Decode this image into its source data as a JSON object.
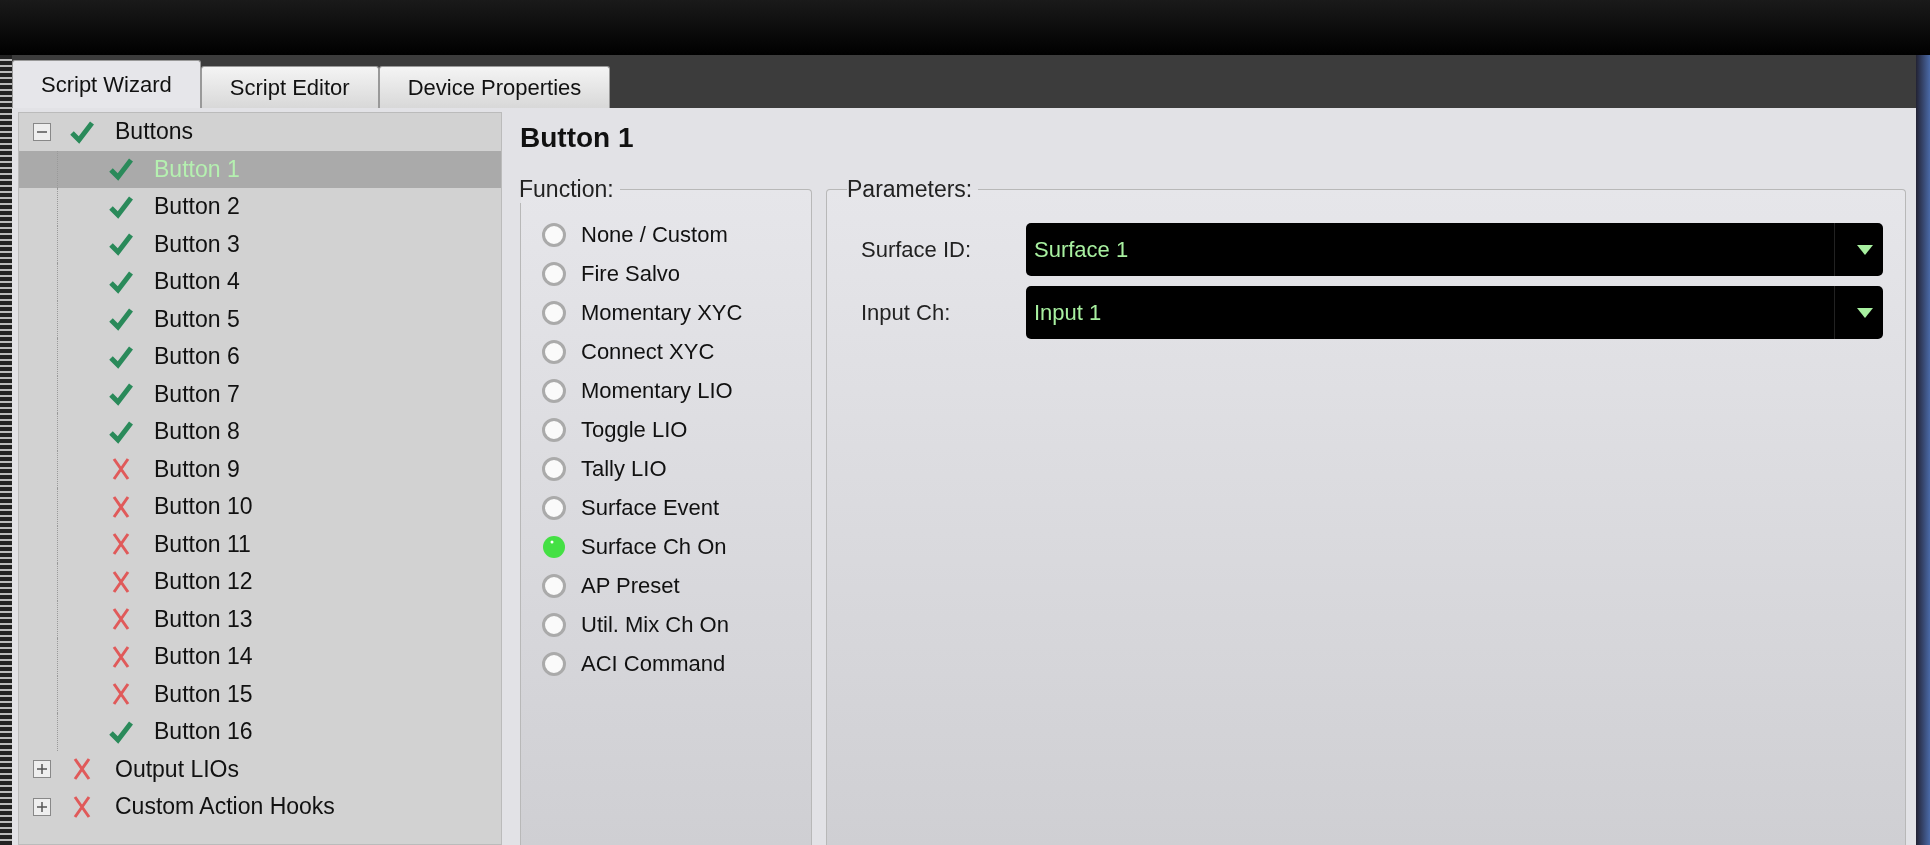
{
  "tabs": [
    {
      "label": "Script Wizard",
      "selected": true
    },
    {
      "label": "Script Editor",
      "selected": false
    },
    {
      "label": "Device Properties",
      "selected": false
    }
  ],
  "tree": [
    {
      "label": "Buttons",
      "kind": "ok",
      "expanded": true,
      "selected": false,
      "children": [
        {
          "label": "Button 1",
          "kind": "ok",
          "selected": true
        },
        {
          "label": "Button 2",
          "kind": "ok",
          "selected": false
        },
        {
          "label": "Button 3",
          "kind": "ok",
          "selected": false
        },
        {
          "label": "Button 4",
          "kind": "ok",
          "selected": false
        },
        {
          "label": "Button 5",
          "kind": "ok",
          "selected": false
        },
        {
          "label": "Button 6",
          "kind": "ok",
          "selected": false
        },
        {
          "label": "Button 7",
          "kind": "ok",
          "selected": false
        },
        {
          "label": "Button 8",
          "kind": "ok",
          "selected": false
        },
        {
          "label": "Button 9",
          "kind": "error",
          "selected": false
        },
        {
          "label": "Button 10",
          "kind": "error",
          "selected": false
        },
        {
          "label": "Button 11",
          "kind": "error",
          "selected": false
        },
        {
          "label": "Button 12",
          "kind": "error",
          "selected": false
        },
        {
          "label": "Button 13",
          "kind": "error",
          "selected": false
        },
        {
          "label": "Button 14",
          "kind": "error",
          "selected": false
        },
        {
          "label": "Button 15",
          "kind": "error",
          "selected": false
        },
        {
          "label": "Button 16",
          "kind": "ok",
          "selected": false
        }
      ]
    },
    {
      "label": "Output LIOs",
      "kind": "error",
      "expanded": false,
      "selected": false
    },
    {
      "label": "Custom Action Hooks",
      "kind": "error",
      "expanded": false,
      "selected": false
    }
  ],
  "detail": {
    "title": "Button 1",
    "function": {
      "label": "Function:",
      "options": [
        {
          "label": "None / Custom",
          "selected": false
        },
        {
          "label": "Fire Salvo",
          "selected": false
        },
        {
          "label": "Momentary XYC",
          "selected": false
        },
        {
          "label": "Connect XYC",
          "selected": false
        },
        {
          "label": "Momentary LIO",
          "selected": false
        },
        {
          "label": "Toggle LIO",
          "selected": false
        },
        {
          "label": "Tally LIO",
          "selected": false
        },
        {
          "label": "Surface Event",
          "selected": false
        },
        {
          "label": "Surface Ch On",
          "selected": true
        },
        {
          "label": "AP Preset",
          "selected": false
        },
        {
          "label": "Util. Mix Ch On",
          "selected": false
        },
        {
          "label": "ACI Command",
          "selected": false
        }
      ]
    },
    "parameters": {
      "label": "Parameters:",
      "fields": [
        {
          "label": "Surface ID:",
          "value": "Surface 1"
        },
        {
          "label": "Input Ch:",
          "value": "Input 1"
        }
      ]
    }
  }
}
